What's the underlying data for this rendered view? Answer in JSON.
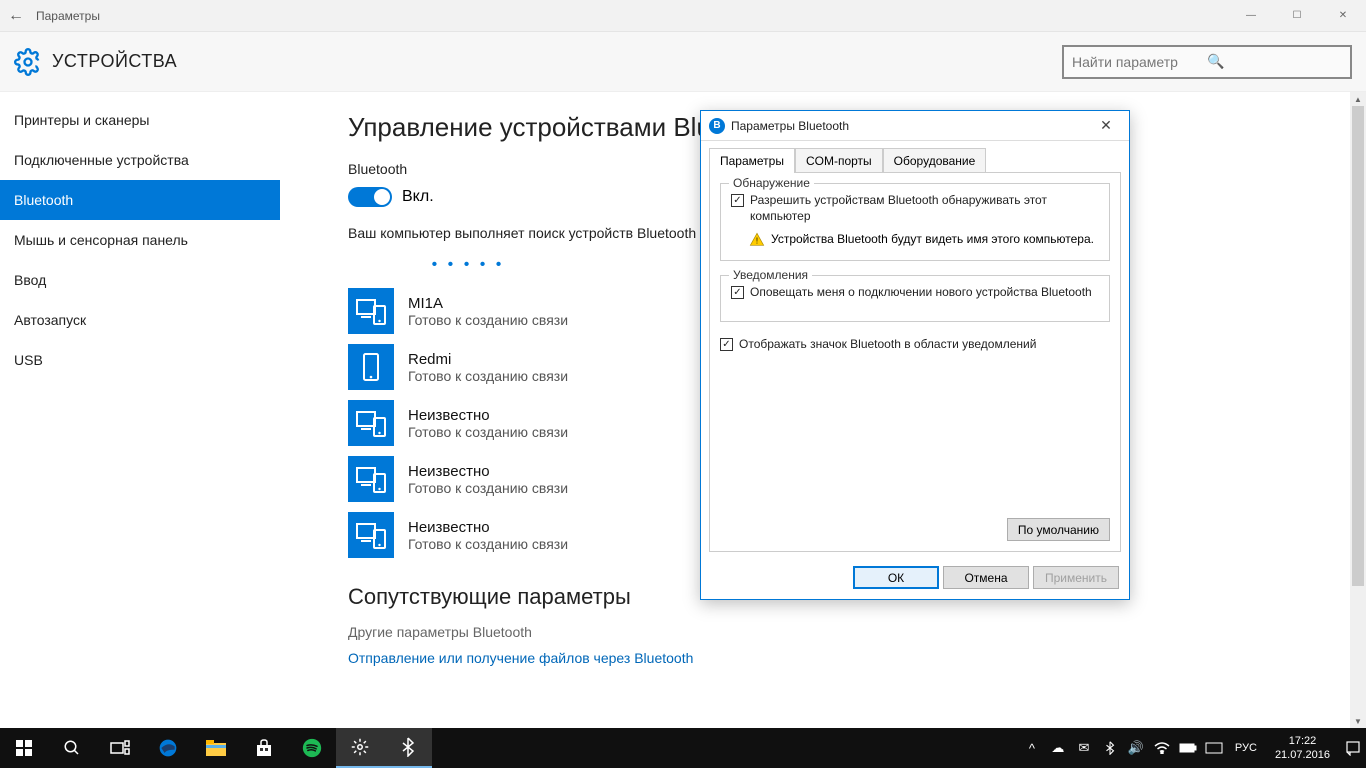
{
  "titlebar": {
    "back": "←",
    "title": "Параметры",
    "min": "—",
    "max": "☐",
    "close": "✕"
  },
  "header": {
    "title": "УСТРОЙСТВА",
    "search_placeholder": "Найти параметр"
  },
  "sidebar": {
    "items": [
      {
        "label": "Принтеры и сканеры"
      },
      {
        "label": "Подключенные устройства"
      },
      {
        "label": "Bluetooth"
      },
      {
        "label": "Мышь и сенсорная панель"
      },
      {
        "label": "Ввод"
      },
      {
        "label": "Автозапуск"
      },
      {
        "label": "USB"
      }
    ]
  },
  "main": {
    "heading": "Управление устройствами Bluetooth",
    "bt_label": "Bluetooth",
    "toggle_state": "Вкл.",
    "desc": "Ваш компьютер выполняет поиск устройств Bluetooth и может быть обнаружен ими.",
    "searching": "• • • • •",
    "devices": [
      {
        "name": "MI1A",
        "status": "Готово к созданию связи",
        "type": "multi"
      },
      {
        "name": "Redmi",
        "status": "Готово к созданию связи",
        "type": "phone"
      },
      {
        "name": "Неизвестно",
        "status": "Готово к созданию связи",
        "type": "multi"
      },
      {
        "name": "Неизвестно",
        "status": "Готово к созданию связи",
        "type": "multi"
      },
      {
        "name": "Неизвестно",
        "status": "Готово к созданию связи",
        "type": "multi"
      }
    ],
    "related_heading": "Сопутствующие параметры",
    "related1": "Другие параметры Bluetooth",
    "related2": "Отправление или получение файлов через Bluetooth"
  },
  "dialog": {
    "title": "Параметры Bluetooth",
    "tabs": [
      "Параметры",
      "COM-порты",
      "Оборудование"
    ],
    "group1": {
      "legend": "Обнаружение",
      "chk": "Разрешить устройствам Bluetooth обнаруживать этот компьютер",
      "warn": "Устройства Bluetooth будут видеть имя этого компьютера."
    },
    "group2": {
      "legend": "Уведомления",
      "chk": "Оповещать меня о подключении нового устройства Bluetooth"
    },
    "chk3": "Отображать значок Bluetooth в области уведомлений",
    "defaults": "По умолчанию",
    "ok": "ОК",
    "cancel": "Отмена",
    "apply": "Применить"
  },
  "taskbar": {
    "lang": "РУС",
    "time": "17:22",
    "date": "21.07.2016"
  }
}
